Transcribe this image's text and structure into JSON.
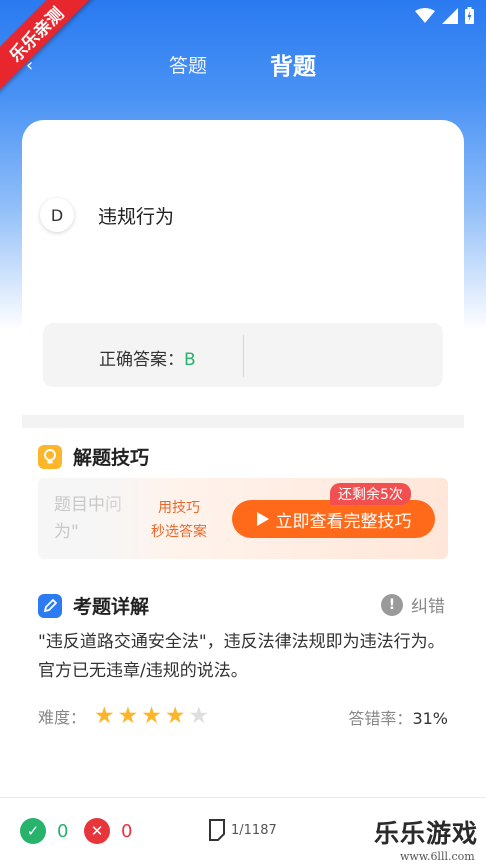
{
  "tabs": [
    {
      "label": "答题"
    },
    {
      "label": "背题"
    }
  ],
  "ribbon": {
    "text": "乐乐亲测"
  },
  "question": {
    "option_letter": "D",
    "option_text": "违规行为",
    "correct_answer_label": "正确答案：",
    "correct_answer_value": "B"
  },
  "tips": {
    "title": "解题技巧",
    "hidden_line1": "题目中问",
    "hidden_line2": "为\"",
    "small_line1": "用技巧",
    "small_line2": "秒选答案",
    "button_label": "立即查看完整技巧",
    "badge": "还剩余5次"
  },
  "explain": {
    "title": "考题详解",
    "report_label": "纠错",
    "text": "\"违反道路交通安全法\"，违反法律法规即为违法行为。官方已无违章/违规的说法。",
    "difficulty_label": "难度：",
    "difficulty_stars": 4,
    "difficulty_max": 5,
    "error_rate_label": "答错率：",
    "error_rate_value": "31%"
  },
  "bottom": {
    "correct_count": "0",
    "wrong_count": "0",
    "page": "1/1187"
  },
  "watermark": {
    "text": "乐乐游戏",
    "url": "www.6lll.com"
  },
  "colors": {
    "brand_blue": "#2a7af0",
    "correct_green": "#27b36b",
    "wrong_red": "#e8353b",
    "tip_orange": "#ff6a1a",
    "star_yellow": "#fdb52a"
  }
}
